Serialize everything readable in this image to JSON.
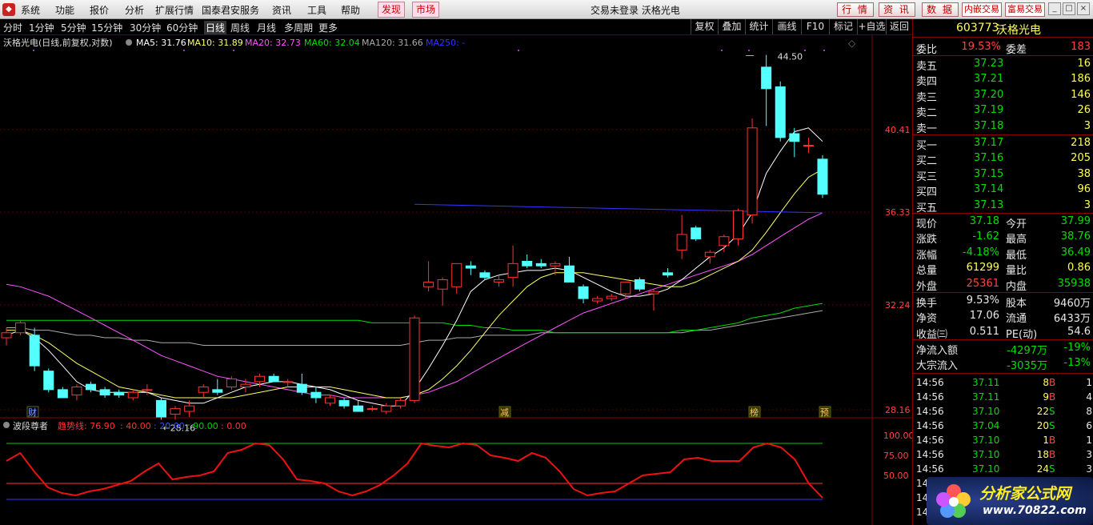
{
  "menu": {
    "items": [
      "系统",
      "功能",
      "报价",
      "分析",
      "扩展行情",
      "国泰君安服务",
      "资讯",
      "工具",
      "帮助"
    ],
    "discover": "发现",
    "market": "市场",
    "title": "交易未登录  沃格光电"
  },
  "topbuttons": [
    "行 情",
    "资 讯",
    "数 据"
  ],
  "smallbuttons": [
    "内嵌交易",
    "富易交易"
  ],
  "window_icons": [
    "minimize-icon",
    "restore-icon",
    "close-icon"
  ],
  "periods": [
    "分时",
    "1分钟",
    "5分钟",
    "15分钟",
    "30分钟",
    "60分钟",
    "日线",
    "周线",
    "月线",
    "多周期",
    "更多"
  ],
  "active_period": "日线",
  "toolbar_right": [
    "复权",
    "叠加",
    "统计",
    "画线",
    "F10",
    "标记",
    "+自选",
    "返回"
  ],
  "legend": {
    "title": "沃格光电(日线,前复权,对数)",
    "ma5": "MA5: 31.76",
    "ma10": "MA10: 31.89",
    "ma20": "MA20: 32.73",
    "ma60": "MA60: 32.04",
    "ma120": "MA120: 31.66",
    "ma250": "MA250: -"
  },
  "price_labels": [
    "40.41",
    "36.33",
    "32.24",
    "28.16"
  ],
  "annotations": {
    "high": "44.50",
    "low": "28.16"
  },
  "event_tags": [
    "财",
    "减",
    "榜",
    "预"
  ],
  "indicator": {
    "name": "波段尊者",
    "trend_label": "趋势线: 76.90",
    "v1": ": 40.00",
    "v2": ": 20.00",
    "v3": ": 90.00",
    "v4": ": 0.00",
    "levels": [
      "100.00",
      "75.00",
      "50.00"
    ]
  },
  "colors": {
    "up": "#ff3333",
    "down": "#54ffff",
    "ma5": "#ffffff",
    "ma10": "#ffff66",
    "ma20": "#ff55ff",
    "ma60": "#00dd00",
    "ma120": "#aaaaaa",
    "ma250": "#3333ff"
  },
  "chart_data": {
    "type": "candlestick",
    "candles": [
      {
        "o": 30.9,
        "h": 31.3,
        "l": 30.6,
        "c": 31.1
      },
      {
        "o": 31.1,
        "h": 31.6,
        "l": 31.0,
        "c": 31.5
      },
      {
        "o": 31.0,
        "h": 31.3,
        "l": 29.6,
        "c": 29.8
      },
      {
        "o": 29.6,
        "h": 29.7,
        "l": 28.8,
        "c": 28.9
      },
      {
        "o": 28.9,
        "h": 29.0,
        "l": 28.6,
        "c": 28.6
      },
      {
        "o": 28.7,
        "h": 29.1,
        "l": 28.5,
        "c": 29.0
      },
      {
        "o": 29.1,
        "h": 29.2,
        "l": 28.8,
        "c": 28.9
      },
      {
        "o": 28.9,
        "h": 29.0,
        "l": 28.6,
        "c": 28.7
      },
      {
        "o": 28.8,
        "h": 28.9,
        "l": 28.6,
        "c": 28.7
      },
      {
        "o": 28.6,
        "h": 28.9,
        "l": 28.5,
        "c": 28.8
      },
      {
        "o": 28.9,
        "h": 29.1,
        "l": 28.7,
        "c": 28.9
      },
      {
        "o": 28.5,
        "h": 28.6,
        "l": 27.8,
        "c": 27.9
      },
      {
        "o": 28.0,
        "h": 28.3,
        "l": 27.8,
        "c": 28.2
      },
      {
        "o": 28.1,
        "h": 28.5,
        "l": 27.9,
        "c": 28.3
      },
      {
        "o": 28.8,
        "h": 29.1,
        "l": 28.6,
        "c": 29.0
      },
      {
        "o": 28.9,
        "h": 29.3,
        "l": 28.7,
        "c": 28.8
      },
      {
        "o": 29.0,
        "h": 29.4,
        "l": 28.9,
        "c": 29.3
      },
      {
        "o": 29.0,
        "h": 29.3,
        "l": 28.8,
        "c": 29.1
      },
      {
        "o": 29.2,
        "h": 29.5,
        "l": 29.0,
        "c": 29.4
      },
      {
        "o": 29.4,
        "h": 29.5,
        "l": 29.2,
        "c": 29.2
      },
      {
        "o": 29.2,
        "h": 29.3,
        "l": 29.0,
        "c": 29.2
      },
      {
        "o": 29.1,
        "h": 29.5,
        "l": 28.7,
        "c": 28.8
      },
      {
        "o": 28.8,
        "h": 29.0,
        "l": 28.4,
        "c": 28.6
      },
      {
        "o": 28.4,
        "h": 28.7,
        "l": 28.3,
        "c": 28.6
      },
      {
        "o": 28.5,
        "h": 28.6,
        "l": 28.2,
        "c": 28.3
      },
      {
        "o": 28.3,
        "h": 28.5,
        "l": 28.1,
        "c": 28.1
      },
      {
        "o": 28.2,
        "h": 28.3,
        "l": 28.1,
        "c": 28.2
      },
      {
        "o": 28.1,
        "h": 28.4,
        "l": 28.0,
        "c": 28.3
      },
      {
        "o": 28.3,
        "h": 28.6,
        "l": 28.2,
        "c": 28.5
      },
      {
        "o": 28.5,
        "h": 31.8,
        "l": 28.4,
        "c": 31.7
      },
      {
        "o": 33.0,
        "h": 34.1,
        "l": 32.8,
        "c": 33.2
      },
      {
        "o": 32.9,
        "h": 33.4,
        "l": 32.2,
        "c": 33.3
      },
      {
        "o": 33.0,
        "h": 34.0,
        "l": 32.7,
        "c": 34.0
      },
      {
        "o": 33.9,
        "h": 34.1,
        "l": 33.5,
        "c": 33.8
      },
      {
        "o": 33.6,
        "h": 33.7,
        "l": 33.3,
        "c": 33.4
      },
      {
        "o": 33.2,
        "h": 33.5,
        "l": 33.0,
        "c": 33.3
      },
      {
        "o": 33.4,
        "h": 34.8,
        "l": 33.0,
        "c": 34.0
      },
      {
        "o": 34.1,
        "h": 34.4,
        "l": 33.8,
        "c": 33.9
      },
      {
        "o": 34.0,
        "h": 34.2,
        "l": 33.8,
        "c": 33.9
      },
      {
        "o": 33.9,
        "h": 34.1,
        "l": 33.5,
        "c": 34.0
      },
      {
        "o": 33.9,
        "h": 34.3,
        "l": 33.2,
        "c": 33.2
      },
      {
        "o": 33.0,
        "h": 33.1,
        "l": 32.3,
        "c": 32.5
      },
      {
        "o": 32.4,
        "h": 32.6,
        "l": 32.3,
        "c": 32.5
      },
      {
        "o": 32.5,
        "h": 32.7,
        "l": 32.4,
        "c": 32.6
      },
      {
        "o": 32.7,
        "h": 33.2,
        "l": 32.5,
        "c": 33.2
      },
      {
        "o": 33.3,
        "h": 33.4,
        "l": 32.8,
        "c": 32.9
      },
      {
        "o": 32.7,
        "h": 32.9,
        "l": 32.0,
        "c": 32.8
      },
      {
        "o": 33.6,
        "h": 33.8,
        "l": 33.4,
        "c": 33.5
      },
      {
        "o": 34.6,
        "h": 36.2,
        "l": 34.2,
        "c": 35.3
      },
      {
        "o": 35.6,
        "h": 35.7,
        "l": 35.0,
        "c": 35.1
      },
      {
        "o": 34.3,
        "h": 34.6,
        "l": 34.0,
        "c": 34.5
      },
      {
        "o": 34.8,
        "h": 35.3,
        "l": 34.5,
        "c": 35.2
      },
      {
        "o": 35.1,
        "h": 36.5,
        "l": 34.8,
        "c": 36.4
      },
      {
        "o": 36.2,
        "h": 41.0,
        "l": 35.8,
        "c": 40.5
      },
      {
        "o": 43.8,
        "h": 44.5,
        "l": 40.6,
        "c": 42.6
      },
      {
        "o": 42.7,
        "h": 43.0,
        "l": 39.8,
        "c": 40.0
      },
      {
        "o": 40.2,
        "h": 40.5,
        "l": 39.0,
        "c": 39.8
      },
      {
        "o": 39.6,
        "h": 40.0,
        "l": 39.2,
        "c": 39.6
      },
      {
        "o": 38.9,
        "h": 39.1,
        "l": 37.0,
        "c": 37.18
      }
    ],
    "ma5": [
      31.0,
      31.2,
      30.9,
      30.4,
      29.8,
      29.2,
      28.9,
      28.8,
      28.8,
      28.8,
      28.8,
      28.6,
      28.5,
      28.4,
      28.4,
      28.6,
      28.8,
      29.0,
      29.1,
      29.2,
      29.2,
      29.1,
      29.0,
      28.9,
      28.7,
      28.5,
      28.4,
      28.3,
      28.3,
      28.9,
      29.7,
      30.6,
      31.6,
      32.8,
      33.3,
      33.5,
      33.6,
      33.7,
      33.7,
      33.8,
      33.7,
      33.4,
      33.1,
      32.8,
      32.6,
      32.6,
      32.7,
      32.9,
      33.3,
      33.8,
      34.3,
      34.7,
      35.3,
      36.3,
      38.2,
      39.3,
      40.3,
      40.5,
      39.8
    ],
    "ma10": [
      31.2,
      31.2,
      31.0,
      30.7,
      30.3,
      29.9,
      29.6,
      29.3,
      29.0,
      28.9,
      28.8,
      28.7,
      28.6,
      28.6,
      28.6,
      28.6,
      28.6,
      28.7,
      28.8,
      28.9,
      29.0,
      29.0,
      29.0,
      29.0,
      28.9,
      28.8,
      28.7,
      28.6,
      28.6,
      28.7,
      28.9,
      29.3,
      29.8,
      30.4,
      31.1,
      31.8,
      32.4,
      33.0,
      33.4,
      33.6,
      33.6,
      33.6,
      33.5,
      33.4,
      33.3,
      33.2,
      33.1,
      33.0,
      33.0,
      33.2,
      33.5,
      33.8,
      34.1,
      34.6,
      35.4,
      36.3,
      37.2,
      38.0,
      38.4
    ],
    "ma20": [
      33.1,
      33.0,
      32.8,
      32.6,
      32.3,
      32.0,
      31.7,
      31.4,
      31.1,
      30.8,
      30.5,
      30.2,
      30.0,
      29.8,
      29.6,
      29.4,
      29.3,
      29.2,
      29.1,
      29.0,
      28.9,
      28.8,
      28.7,
      28.7,
      28.6,
      28.6,
      28.6,
      28.6,
      28.6,
      28.7,
      28.8,
      29.0,
      29.2,
      29.5,
      29.8,
      30.1,
      30.4,
      30.7,
      31.0,
      31.3,
      31.6,
      31.9,
      32.1,
      32.3,
      32.5,
      32.7,
      32.9,
      33.1,
      33.3,
      33.5,
      33.7,
      33.9,
      34.1,
      34.4,
      34.8,
      35.2,
      35.6,
      36.0,
      36.3
    ],
    "ma60": [
      31.6,
      31.6,
      31.6,
      31.6,
      31.6,
      31.6,
      31.6,
      31.6,
      31.6,
      31.6,
      31.6,
      31.6,
      31.6,
      31.6,
      31.6,
      31.6,
      31.6,
      31.6,
      31.6,
      31.6,
      31.6,
      31.6,
      31.6,
      31.6,
      31.6,
      31.6,
      31.5,
      31.5,
      31.5,
      31.5,
      31.5,
      31.5,
      31.4,
      31.4,
      31.3,
      31.3,
      31.2,
      31.2,
      31.2,
      31.1,
      31.1,
      31.1,
      31.1,
      31.1,
      31.1,
      31.1,
      31.1,
      31.1,
      31.2,
      31.2,
      31.3,
      31.4,
      31.5,
      31.7,
      31.8,
      31.9,
      32.1,
      32.2,
      32.3
    ],
    "ma120": [
      31.3,
      31.3,
      31.2,
      31.2,
      31.1,
      31.0,
      31.0,
      30.9,
      30.9,
      30.8,
      30.8,
      30.7,
      30.7,
      30.7,
      30.6,
      30.6,
      30.6,
      30.6,
      30.6,
      30.6,
      30.6,
      30.6,
      30.6,
      30.6,
      30.6,
      30.6,
      30.6,
      30.6,
      30.6,
      30.7,
      30.8,
      30.8,
      30.9,
      30.9,
      31.0,
      31.0,
      31.0,
      31.0,
      31.1,
      31.1,
      31.1,
      31.1,
      31.1,
      31.1,
      31.1,
      31.1,
      31.1,
      31.1,
      31.1,
      31.2,
      31.2,
      31.3,
      31.4,
      31.5,
      31.6,
      31.7,
      31.8,
      31.9,
      32.0
    ],
    "ma250_segment": [
      {
        "i": 29,
        "v": 36.7
      },
      {
        "i": 58,
        "v": 36.3
      }
    ],
    "indicator_values": [
      68,
      78,
      55,
      35,
      28,
      25,
      30,
      33,
      38,
      43,
      55,
      65,
      45,
      48,
      50,
      55,
      78,
      82,
      90,
      88,
      70,
      45,
      43,
      40,
      30,
      25,
      30,
      38,
      50,
      65,
      90,
      87,
      85,
      90,
      88,
      75,
      72,
      68,
      78,
      72,
      55,
      33,
      25,
      28,
      30,
      40,
      50,
      52,
      54,
      70,
      72,
      68,
      68,
      68,
      85,
      90,
      85,
      70,
      40,
      22
    ]
  },
  "quote": {
    "code": "603773",
    "name": "沃格光电",
    "weibi_label": "委比",
    "weibi": "19.53%",
    "weicha_label": "委差",
    "weicha": "183",
    "asks": [
      {
        "label": "卖五",
        "price": "37.23",
        "vol": "16"
      },
      {
        "label": "卖四",
        "price": "37.21",
        "vol": "186"
      },
      {
        "label": "卖三",
        "price": "37.20",
        "vol": "146"
      },
      {
        "label": "卖二",
        "price": "37.19",
        "vol": "26"
      },
      {
        "label": "卖一",
        "price": "37.18",
        "vol": "3"
      }
    ],
    "bids": [
      {
        "label": "买一",
        "price": "37.17",
        "vol": "218"
      },
      {
        "label": "买二",
        "price": "37.16",
        "vol": "205"
      },
      {
        "label": "买三",
        "price": "37.15",
        "vol": "38"
      },
      {
        "label": "买四",
        "price": "37.14",
        "vol": "96"
      },
      {
        "label": "买五",
        "price": "37.13",
        "vol": "3"
      }
    ],
    "stats": [
      {
        "l1": "现价",
        "v1": "37.18",
        "c1": "green",
        "l2": "今开",
        "v2": "37.99",
        "c2": "green"
      },
      {
        "l1": "涨跌",
        "v1": "-1.62",
        "c1": "green",
        "l2": "最高",
        "v2": "38.76",
        "c2": "green"
      },
      {
        "l1": "涨幅",
        "v1": "-4.18%",
        "c1": "green",
        "l2": "最低",
        "v2": "36.49",
        "c2": "green"
      },
      {
        "l1": "总量",
        "v1": "61299",
        "c1": "yellow",
        "l2": "量比",
        "v2": "0.86",
        "c2": "yellow"
      },
      {
        "l1": "外盘",
        "v1": "25361",
        "c1": "red",
        "l2": "内盘",
        "v2": "35938",
        "c2": "green"
      }
    ],
    "fund": [
      {
        "l1": "换手",
        "v1": "9.53%",
        "l2": "股本",
        "v2": "9460万"
      },
      {
        "l1": "净资",
        "v1": "17.06",
        "l2": "流通",
        "v2": "6433万"
      },
      {
        "l1": "收益㈢",
        "v1": "0.511",
        "l2": "PE(动)",
        "v2": "54.6"
      }
    ],
    "flow": [
      {
        "l": "净流入额",
        "v": "-4297万",
        "p": "-19%"
      },
      {
        "l": "大宗流入",
        "v": "-3035万",
        "p": "-13%"
      }
    ],
    "ticks": [
      {
        "t": "14:56",
        "p": "37.11",
        "v": "8",
        "s": "B",
        "n": "1"
      },
      {
        "t": "14:56",
        "p": "37.11",
        "v": "9",
        "s": "B",
        "n": "4"
      },
      {
        "t": "14:56",
        "p": "37.10",
        "v": "22",
        "s": "S",
        "n": "8"
      },
      {
        "t": "14:56",
        "p": "37.04",
        "v": "20",
        "s": "S",
        "n": "6"
      },
      {
        "t": "14:56",
        "p": "37.10",
        "v": "1",
        "s": "B",
        "n": "1"
      },
      {
        "t": "14:56",
        "p": "37.10",
        "v": "18",
        "s": "B",
        "n": "3"
      },
      {
        "t": "14:56",
        "p": "37.10",
        "v": "24",
        "s": "S",
        "n": "3"
      },
      {
        "t": "14:56",
        "p": "37.10",
        "v": "",
        "s": "",
        "n": ""
      },
      {
        "t": "14:56",
        "p": "",
        "v": "",
        "s": "",
        "n": ""
      },
      {
        "t": "14:56",
        "p": "",
        "v": "",
        "s": "",
        "n": ""
      }
    ]
  },
  "brand": {
    "name": "分析家公式网",
    "url": "www.70822.com"
  }
}
